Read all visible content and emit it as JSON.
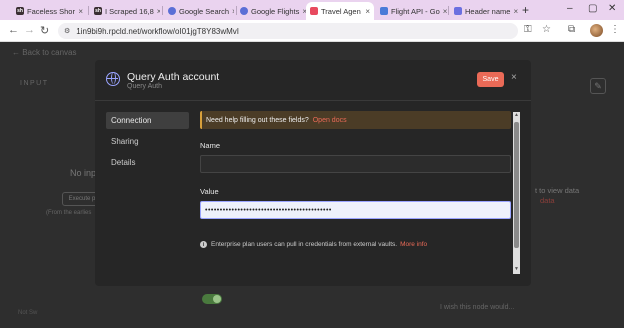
{
  "browser": {
    "tabs": [
      {
        "label": "Faceless Shor",
        "fav": "sh",
        "fav_color": "#3b2f33"
      },
      {
        "label": "I Scraped 16,8",
        "fav": "sh",
        "fav_color": "#3b2f33"
      },
      {
        "label": "Google Search",
        "fav": "",
        "fav_color": "#5b6fd6"
      },
      {
        "label": "Google Flights",
        "fav": "",
        "fav_color": "#5b6fd6"
      },
      {
        "label": "Travel Agen",
        "fav": "",
        "fav_color": "#e84a5f",
        "active": true
      },
      {
        "label": "Flight API - Go",
        "fav": "",
        "fav_color": "#4a7bd8"
      },
      {
        "label": "Header name",
        "fav": "",
        "fav_color": "#6b6fe0"
      }
    ],
    "url": "1in9bi9h.rpcld.net/workflow/oI01jgT8Y83wMvI"
  },
  "app": {
    "back": "← Back to canvas",
    "input_label": "INPUT",
    "no_input": "No inp",
    "execute": "Execute p",
    "from_text": "(From the earlies",
    "view_data": "t to view data",
    "view_data_red": "data",
    "wish": "I wish this node would...",
    "bottom_left": "Not Sw"
  },
  "modal": {
    "title": "Query Auth account",
    "subtitle": "Query Auth",
    "save_label": "Save",
    "nav": [
      "Connection",
      "Sharing",
      "Details"
    ],
    "banner_text": "Need help filling out these fields?",
    "banner_link": "Open docs",
    "name_label": "Name",
    "name_value": "",
    "value_label": "Value",
    "value_value": "•••••••••••••••••••••••••••••••••••••••••••",
    "info_text": "Enterprise plan users can pull in credentials from external vaults.",
    "info_link": "More info"
  },
  "colors": {
    "accent": "#ea6a57",
    "banner": "#4b3c26"
  }
}
